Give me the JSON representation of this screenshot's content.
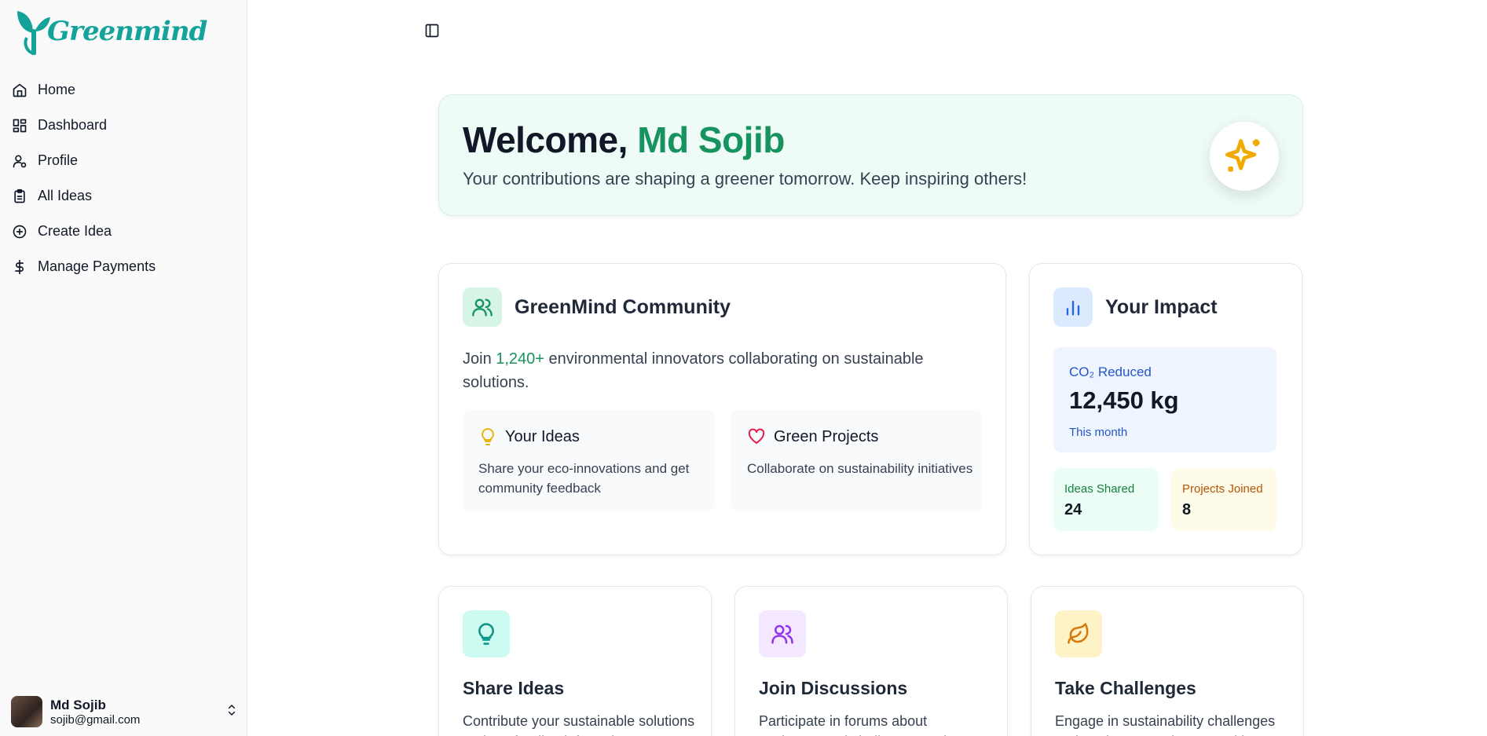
{
  "brand": {
    "name": "Greenmind",
    "color": "#14a39a"
  },
  "sidebar": {
    "items": [
      {
        "label": "Home",
        "icon": "home-icon"
      },
      {
        "label": "Dashboard",
        "icon": "dashboard-icon"
      },
      {
        "label": "Profile",
        "icon": "user-icon"
      },
      {
        "label": "All Ideas",
        "icon": "clipboard-icon"
      },
      {
        "label": "Create Idea",
        "icon": "plus-circle-icon"
      },
      {
        "label": "Manage Payments",
        "icon": "dollar-icon"
      }
    ]
  },
  "user": {
    "name": "Md Sojib",
    "email": "sojib@gmail.com"
  },
  "welcome": {
    "greeting": "Welcome, ",
    "name": "Md Sojib",
    "subtitle": "Your contributions are shaping a greener tomorrow. Keep inspiring others!"
  },
  "community": {
    "title": "GreenMind Community",
    "text_before": "Join ",
    "count": "1,240+",
    "text_after": " environmental innovators collaborating on sustainable solutions.",
    "boxes": [
      {
        "title": "Your Ideas",
        "desc": "Share your eco-innovations and get community feedback",
        "icon": "lightbulb-icon"
      },
      {
        "title": "Green Projects",
        "desc": "Collaborate on sustainability initiatives",
        "icon": "heart-icon"
      }
    ]
  },
  "impact": {
    "title": "Your Impact",
    "co2_label": "CO₂ Reduced",
    "co2_value": "12,450 kg",
    "co2_period": "This month",
    "ideas_label": "Ideas Shared",
    "ideas_value": "24",
    "projects_label": "Projects Joined",
    "projects_value": "8"
  },
  "features": [
    {
      "title": "Share Ideas",
      "desc": "Contribute your sustainable solutions and get feedback from the community",
      "icon": "lightbulb-icon",
      "accent": "#0d9488"
    },
    {
      "title": "Join Discussions",
      "desc": "Participate in forums about environmental challenges and solutions",
      "icon": "users-icon",
      "accent": "#9333ea"
    },
    {
      "title": "Take Challenges",
      "desc": "Engage in sustainability challenges and track your environmental impact",
      "icon": "leaf-icon",
      "accent": "#d97706"
    }
  ]
}
